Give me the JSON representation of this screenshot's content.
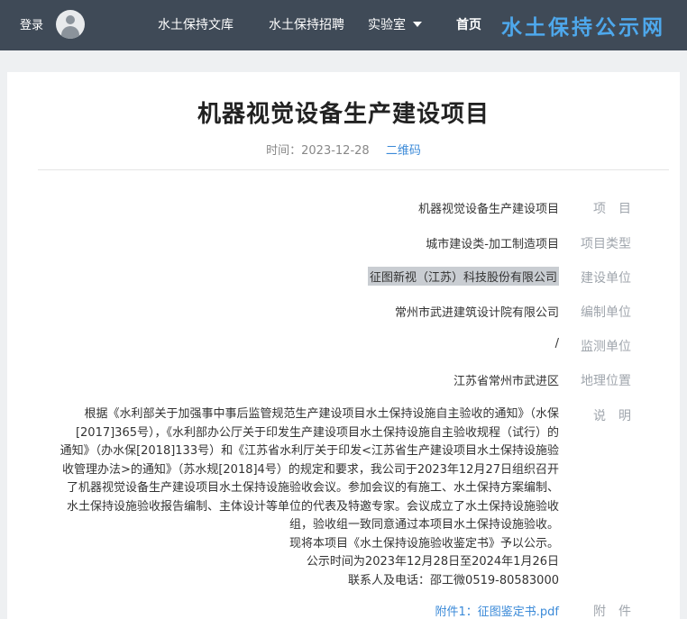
{
  "nav": {
    "logo": "水土保持公示网",
    "home": "首页",
    "lab": "实验室",
    "recruit": "水土保持招聘",
    "library": "水土保持文库",
    "login": "登录"
  },
  "article": {
    "title": "机器视觉设备生产建设项目",
    "time_label": "时间：",
    "time_value": "2023-12-28",
    "qr_label": "二维码",
    "fields": [
      {
        "label": "项　目",
        "value": "机器视觉设备生产建设项目"
      },
      {
        "label": "项目类型",
        "value": "城市建设类-加工制造项目"
      },
      {
        "label": "建设单位",
        "value": "征图新视（江苏）科技股份有限公司"
      },
      {
        "label": "编制单位",
        "value": "常州市武进建筑设计院有限公司"
      },
      {
        "label": "监测单位",
        "value": "/"
      },
      {
        "label": "地理位置",
        "value": "江苏省常州市武进区"
      }
    ],
    "desc_label": "说　明",
    "desc_lines": [
      "根据《水利部关于加强事中事后监管规范生产建设项目水土保持设施自主验收的通知》（水保",
      "[2017]365号），《水利部办公厅关于印发生产建设项目水土保持设施自主验收规程（试行）的",
      "通知》（办水保[2018]133号）和《江苏省水利厅关于印发<江苏省生产建设项目水土保持设施验",
      "收管理办法>的通知》（苏水规[2018]4号）的规定和要求，我公司于2023年12月27日组织召开",
      "了机器视觉设备生产建设项目水土保持设施验收会议。参加会议的有施工、水土保持方案编制、",
      "水土保持设施验收报告编制、主体设计等单位的代表及特邀专家。会议成立了水土保持设施验收",
      "组，验收组一致同意通过本项目水土保持设施验收。",
      "现将本项目《水土保持设施验收鉴定书》予以公示。",
      "公示时间为2023年12月28日至2024年1月26日",
      "联系人及电话：邵工微0519-80583000"
    ],
    "attach_label": "附　件",
    "attach_value": "附件1：征图鉴定书.pdf"
  }
}
